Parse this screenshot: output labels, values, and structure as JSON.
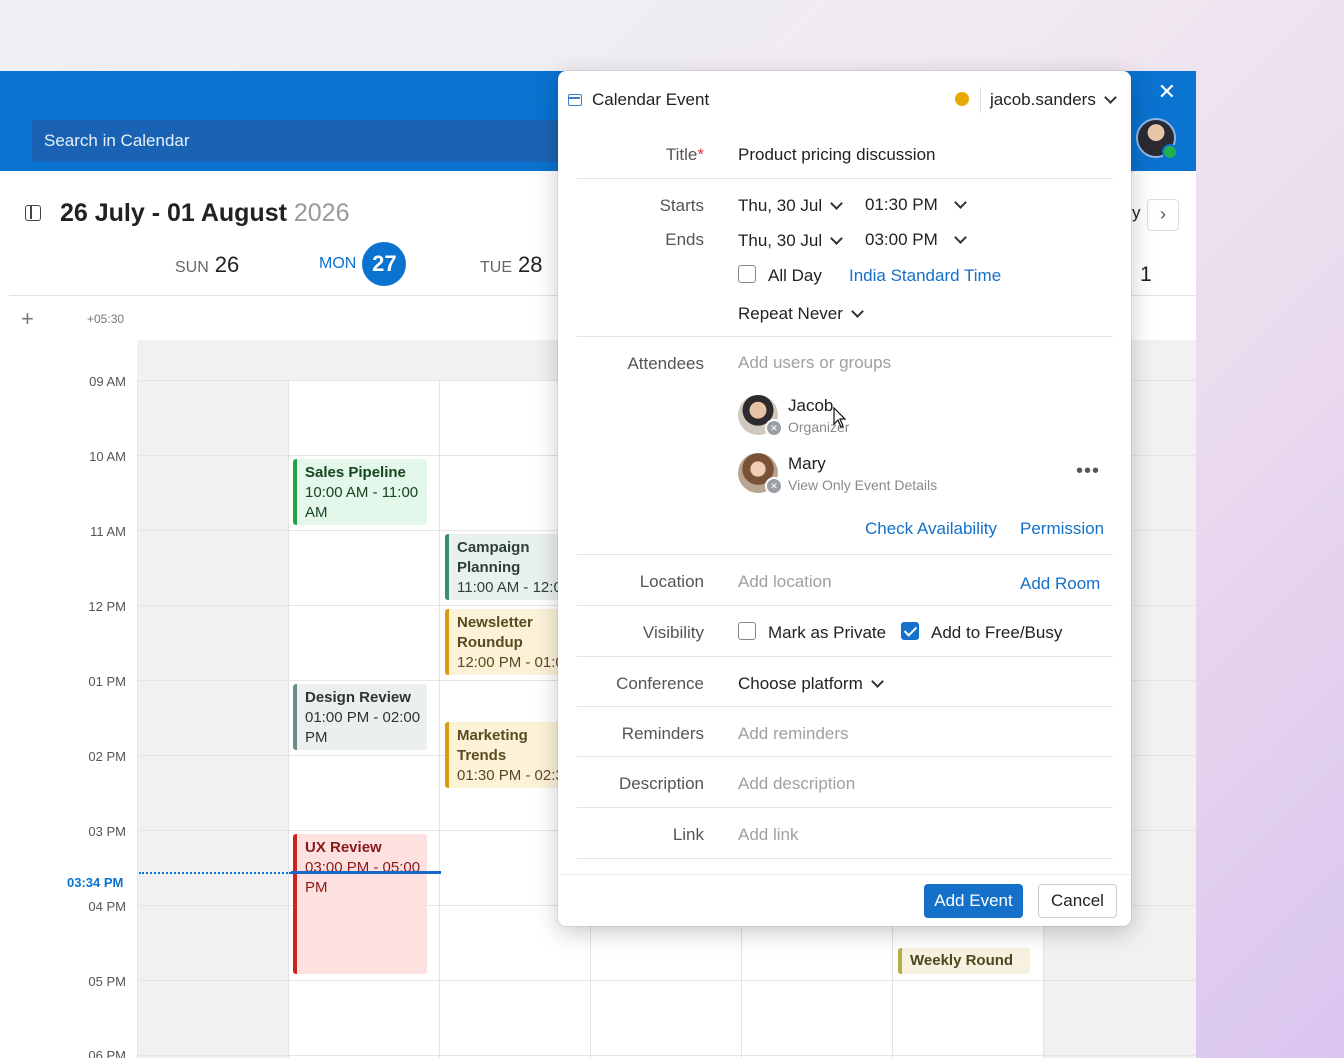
{
  "topbar": {
    "search_placeholder": "Search in Calendar",
    "close_glyph": "✕"
  },
  "calendar": {
    "range_title": "26 July - 01 August",
    "range_year": "2026",
    "peek_header_1": "y",
    "peek_header_2": "1",
    "days": [
      {
        "name": "SUN",
        "num": "26"
      },
      {
        "name": "MON",
        "num": "27"
      },
      {
        "name": "TUE",
        "num": "28"
      }
    ],
    "timezone_offset": "+05:30",
    "times": [
      "09 AM",
      "10 AM",
      "11 AM",
      "12 PM",
      "01 PM",
      "02 PM",
      "03 PM",
      "04 PM",
      "05 PM",
      "06 PM"
    ],
    "now_label": "03:34 PM",
    "events": [
      {
        "title": "Sales Pipeline",
        "time": "10:00 AM - 11:00 AM"
      },
      {
        "title": "Campaign Planning",
        "time": "11:00 AM - 12:0"
      },
      {
        "title": "Newsletter Roundup",
        "time": "12:00 PM - 01:0"
      },
      {
        "title": "Design Review",
        "time": "01:00 PM - 02:00 PM"
      },
      {
        "title": "Marketing Trends",
        "time": "01:30 PM - 02:3"
      },
      {
        "title": "UX Review",
        "time": "03:00 PM - 05:00 PM"
      },
      {
        "title": "Weekly Round",
        "time": ""
      }
    ]
  },
  "dialog": {
    "header_title": "Calendar Event",
    "account": "jacob.sanders",
    "title_label": "Title",
    "title_required": "*",
    "title_value": "Product pricing discussion",
    "starts_label": "Starts",
    "starts_date": "Thu, 30 Jul",
    "starts_time": "01:30 PM",
    "ends_label": "Ends",
    "ends_date": "Thu, 30 Jul",
    "ends_time": "03:00 PM",
    "all_day_label": "All Day",
    "all_day_checked": false,
    "timezone": "India Standard Time",
    "repeat": "Repeat Never",
    "attendees_label": "Attendees",
    "attendees_placeholder": "Add users or groups",
    "attendees": [
      {
        "name": "Jacob",
        "role": "Organizer"
      },
      {
        "name": "Mary",
        "role": "View Only Event Details"
      }
    ],
    "more_glyph": "•••",
    "check_availability": "Check Availability",
    "permission": "Permission",
    "location_label": "Location",
    "location_placeholder": "Add location",
    "add_room": "Add Room",
    "visibility_label": "Visibility",
    "mark_private": "Mark as Private",
    "mark_private_checked": false,
    "add_free_busy": "Add to Free/Busy",
    "add_free_busy_checked": true,
    "conference_label": "Conference",
    "conference_value": "Choose platform",
    "reminders_label": "Reminders",
    "reminders_placeholder": "Add reminders",
    "description_label": "Description",
    "description_placeholder": "Add description",
    "link_label": "Link",
    "link_placeholder": "Add link",
    "add_event": "Add Event",
    "cancel": "Cancel"
  }
}
